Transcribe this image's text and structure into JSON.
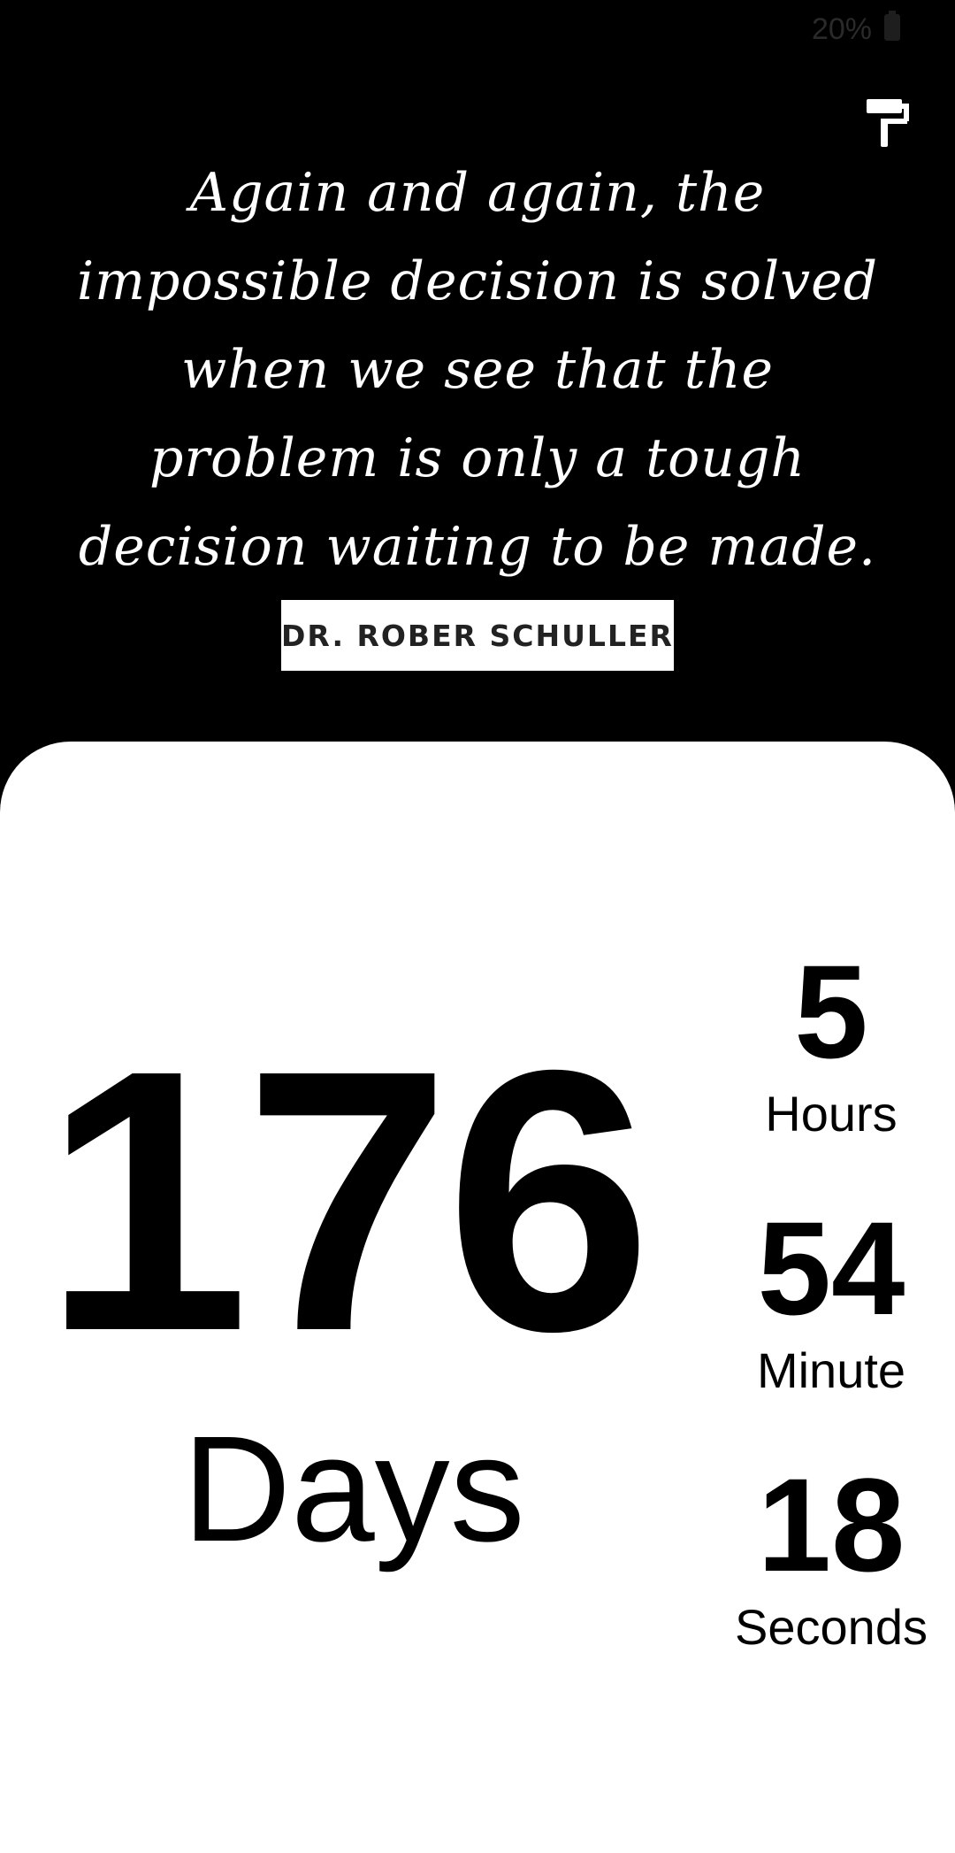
{
  "status_bar": {
    "battery_text": "20%",
    "battery_icon": "battery-icon"
  },
  "toolbar": {
    "theme_icon": "paint-roller-icon"
  },
  "quote": {
    "text": "Again and again, the impossible decision is solved when we see that the problem is only a tough decision waiting to be made.",
    "author": "DR. ROBER SCHULLER"
  },
  "countdown": {
    "days": "176",
    "days_label": "Days",
    "hours": "5",
    "hours_label": "Hours",
    "minutes": "54",
    "minutes_label": "Minute",
    "seconds": "18",
    "seconds_label": "Seconds"
  },
  "colors": {
    "background": "#000000",
    "panel": "#ffffff",
    "text_light": "#ffffff",
    "text_dark": "#000000"
  }
}
